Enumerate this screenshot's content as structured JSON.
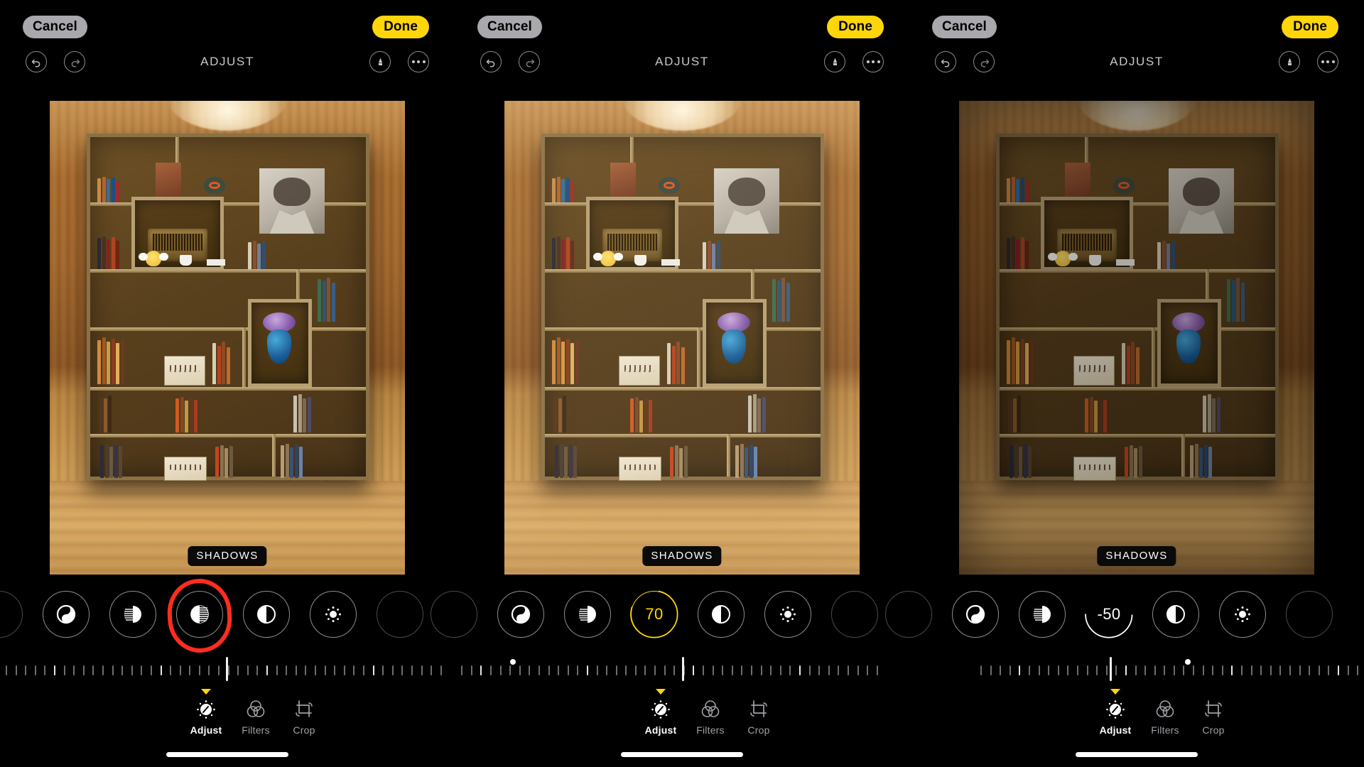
{
  "app": {
    "title": "ADJUST",
    "mode": "Photos Editor"
  },
  "header": {
    "cancel_label": "Cancel",
    "done_label": "Done",
    "title": "ADJUST",
    "icons": {
      "undo": "undo-icon",
      "redo": "redo-icon",
      "markup": "markup-pen-icon",
      "more": "more-options-icon"
    }
  },
  "photo": {
    "overlay_label": "SHADOWS",
    "subject": "miniature bookshelf diorama on wooden desk"
  },
  "adjustments": {
    "tools": [
      {
        "name": "auto-enhance",
        "icon": "auto-enhance-icon"
      },
      {
        "name": "exposure",
        "icon": "exposure-icon"
      },
      {
        "name": "brilliance",
        "icon": "brilliance-icon"
      },
      {
        "name": "highlights",
        "icon": "highlights-icon"
      },
      {
        "name": "shadows",
        "icon": "shadows-icon"
      },
      {
        "name": "contrast",
        "icon": "contrast-icon"
      },
      {
        "name": "brightness",
        "icon": "brightness-icon"
      },
      {
        "name": "black-point",
        "icon": "black-point-icon"
      }
    ],
    "selected_tool": "shadows"
  },
  "tabbar": {
    "items": [
      {
        "label": "Adjust",
        "icon": "adjust-dial-icon",
        "active": true
      },
      {
        "label": "Filters",
        "icon": "filters-circles-icon",
        "active": false
      },
      {
        "label": "Crop",
        "icon": "crop-rotate-icon",
        "active": false
      }
    ]
  },
  "colors": {
    "accent_yellow": "#ffd60a",
    "cancel_gray": "#a8a8ad",
    "annotation_red": "#ff2d20",
    "background": "#000000",
    "tick_inactive": "#6d6d72",
    "tick_active": "#e8e8ec"
  },
  "panels": [
    {
      "id": "panel-1",
      "step_note": "default shadows, dial unselected, red annotation ring around shadows control",
      "shadows_value": "",
      "shadows_value_display": "",
      "value_color": "none",
      "slider_percent": 50,
      "dot_percent": null,
      "annotation": "red-circle-highlight",
      "grade": "g0"
    },
    {
      "id": "panel-2",
      "step_note": "shadows raised to 70, dial shows value in yellow",
      "shadows_value": 70,
      "shadows_value_display": "70",
      "value_color": "#ffd60a",
      "slider_percent": 69,
      "dot_percent": 25,
      "annotation": "none",
      "grade": "g70"
    },
    {
      "id": "panel-3",
      "step_note": "shadows lowered to -50, dial shows value in white",
      "shadows_value": -50,
      "shadows_value_display": "-50",
      "value_color": "#ffffff",
      "slider_percent": 31,
      "dot_percent": 75,
      "annotation": "none",
      "grade": "gm50"
    }
  ]
}
